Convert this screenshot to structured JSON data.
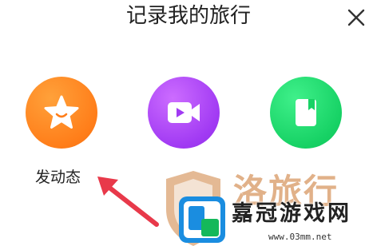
{
  "header": {
    "title": "记录我的旅行",
    "close_icon": "close-icon"
  },
  "actions": [
    {
      "label": "发动态",
      "icon": "star-icon",
      "color": "#ff7e1a"
    },
    {
      "icon": "video-camera-icon",
      "color": "#a13af3"
    },
    {
      "icon": "bookmark-book-icon",
      "color": "#17d265"
    }
  ],
  "arrow_color": "#e8394a",
  "watermark": {
    "faded_text": "洛旅行",
    "name": "嘉冠游戏网",
    "url": "www.03mm.net",
    "logo_colors": [
      "#1a8de0",
      "#14b85a"
    ]
  }
}
